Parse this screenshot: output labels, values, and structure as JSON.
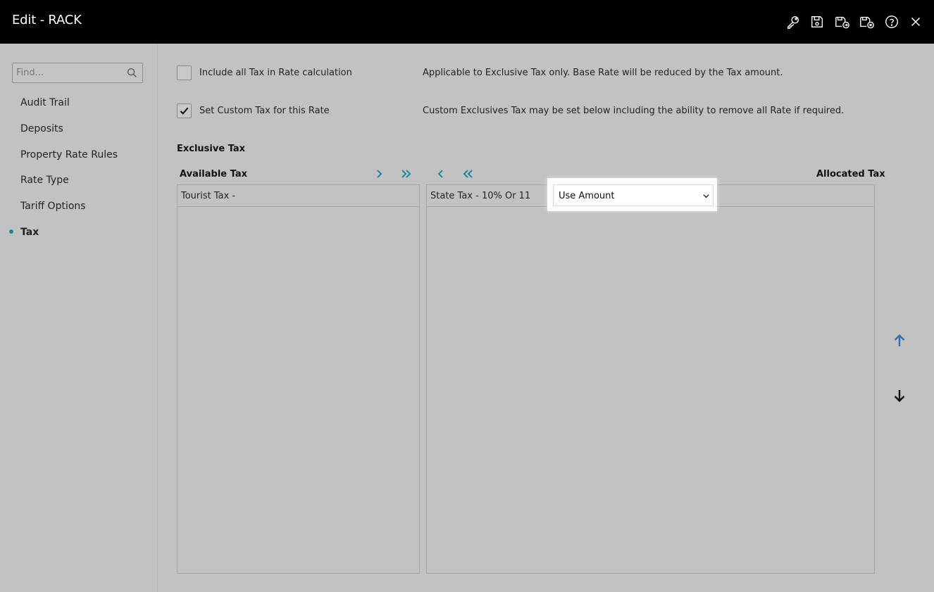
{
  "window": {
    "title": "Edit - RACK",
    "toolbar_icons": [
      "key-icon",
      "save-icon",
      "save-and-go-icon",
      "save-and-close-icon",
      "help-icon",
      "close-icon"
    ]
  },
  "sidebar": {
    "search_placeholder": "Find...",
    "items": [
      {
        "label": "Audit Trail"
      },
      {
        "label": "Deposits"
      },
      {
        "label": "Property Rate Rules"
      },
      {
        "label": "Rate Type"
      },
      {
        "label": "Tariff Options"
      },
      {
        "label": "Tax",
        "active": true
      }
    ]
  },
  "options": {
    "include_all_tax": {
      "label": "Include all Tax in Rate calculation",
      "checked": false,
      "description": "Applicable to Exclusive Tax only. Base Rate will be reduced by the Tax amount."
    },
    "custom_tax": {
      "label": "Set Custom Tax for this Rate",
      "checked": true,
      "description": "Custom Exclusives Tax may be set below including the ability to remove all Rate if required."
    }
  },
  "exclusive_tax": {
    "section_title": "Exclusive Tax",
    "available_header": "Available Tax",
    "allocated_header": "Allocated Tax",
    "available_items": [
      "Tourist Tax -"
    ],
    "allocated_items": [
      {
        "label": "State Tax - 10% Or 11",
        "mode": "Use Amount"
      }
    ]
  },
  "colors": {
    "accent": "#1a8a9a",
    "move_up": "#2f6fb0",
    "move_down": "#111111",
    "titlebar": "#000000"
  }
}
